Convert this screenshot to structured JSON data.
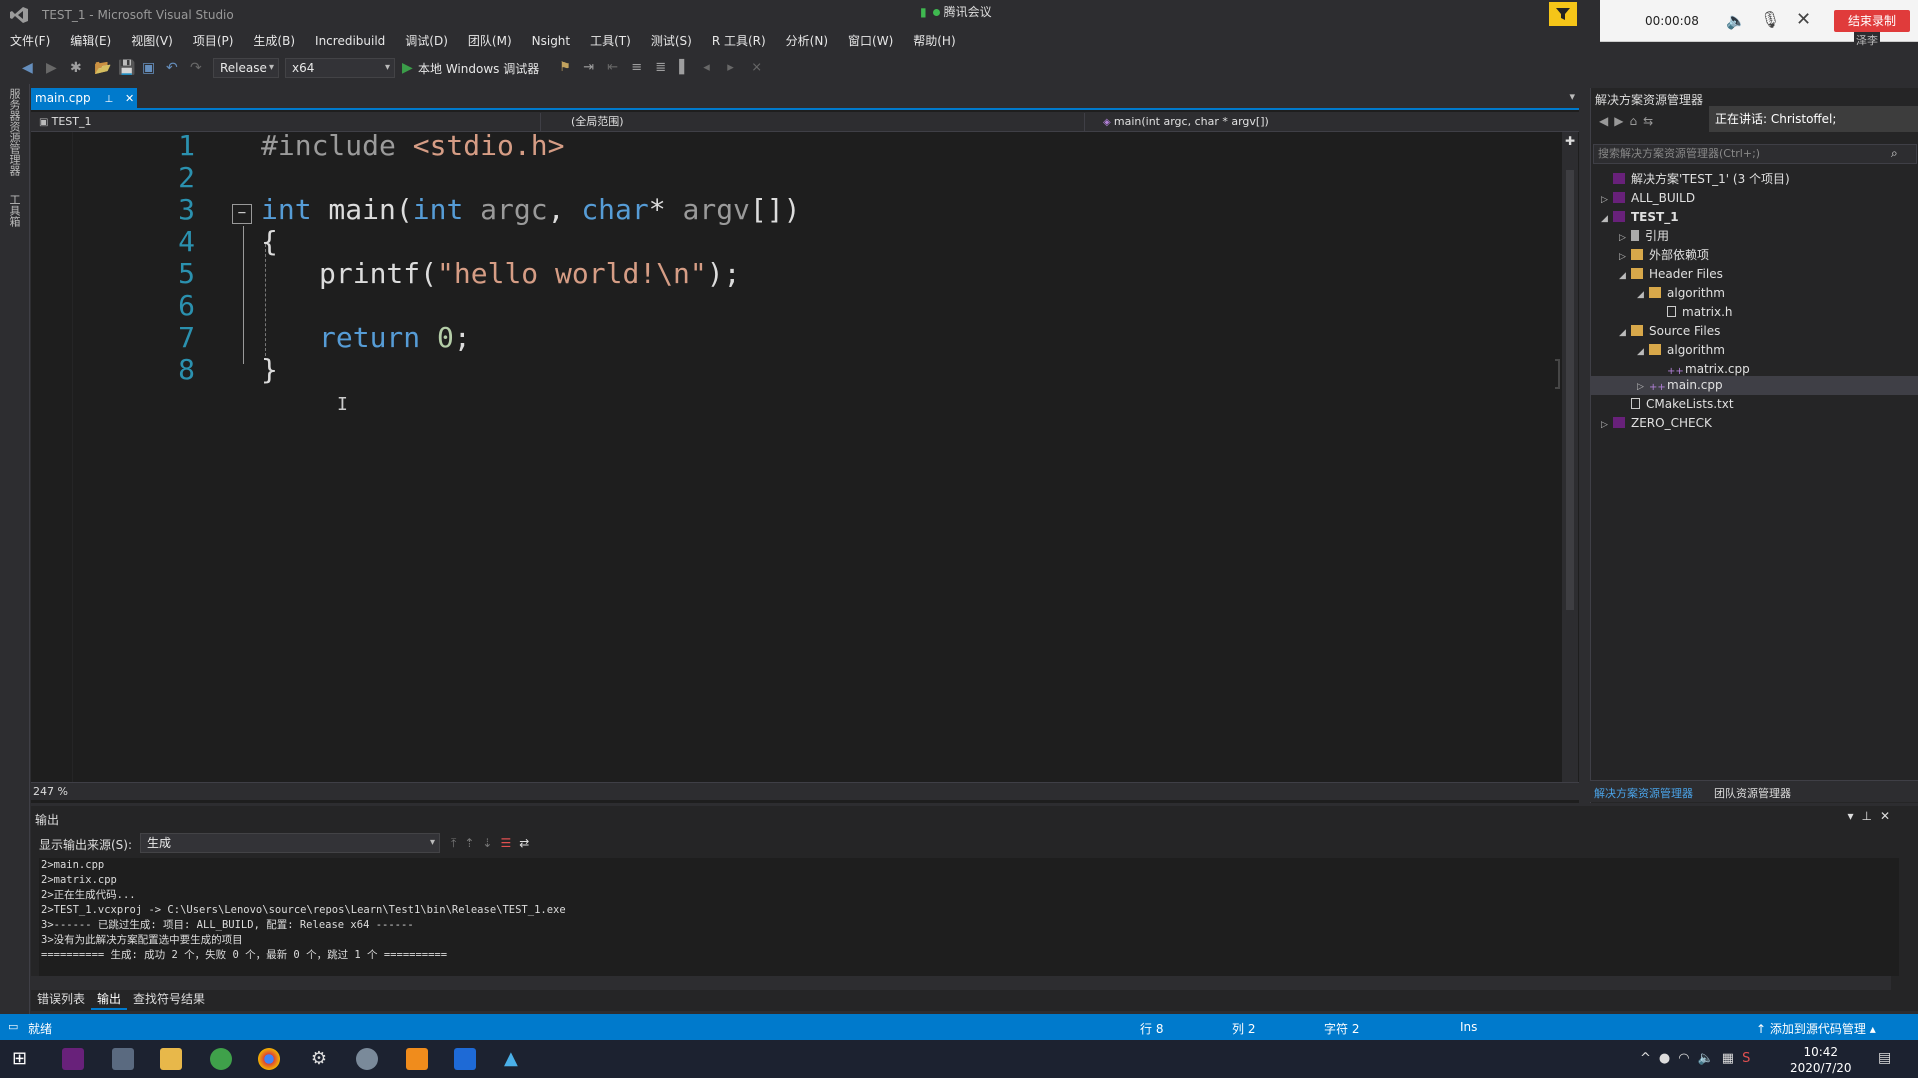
{
  "window": {
    "title": "TEST_1 - Microsoft Visual Studio",
    "meeting": "腾讯会议"
  },
  "recorder": {
    "time": "00:00:08",
    "stop_label": "结束录制",
    "overlay_name": "泽李"
  },
  "menu": [
    "文件(F)",
    "编辑(E)",
    "视图(V)",
    "项目(P)",
    "生成(B)",
    "Incredibuild",
    "调试(D)",
    "团队(M)",
    "Nsight",
    "工具(T)",
    "测试(S)",
    "R 工具(R)",
    "分析(N)",
    "窗口(W)",
    "帮助(H)"
  ],
  "toolbar": {
    "config": "Release",
    "platform": "x64",
    "debugger": "本地 Windows 调试器"
  },
  "left_strip": {
    "tab1": "服务器资源管理器",
    "tab2": "工具箱"
  },
  "editor": {
    "tab": "main.cpp",
    "nav_project": "TEST_1",
    "nav_scope": "(全局范围)",
    "nav_function": "main(int argc, char * argv[])",
    "zoom": "247 %",
    "line_numbers": [
      "1",
      "2",
      "3",
      "4",
      "5",
      "6",
      "7",
      "8"
    ],
    "code": {
      "l1_pp": "#include",
      "l1_inc": " <stdio.h>",
      "l3_kw": "int",
      "l3_a": " main(",
      "l3_kw2": "int",
      "l3_p1": " argc",
      "l3_b": ", ",
      "l3_kw3": "char",
      "l3_c": "* ",
      "l3_p2": "argv",
      "l3_d": "[])",
      "l4": "{",
      "l5_a": "printf(",
      "l5_str": "\"hello world!\\n\"",
      "l5_b": ");",
      "l7_kw": "return",
      "l7_num": " 0",
      "l7_b": ";",
      "l8": "}"
    }
  },
  "solution": {
    "title": "解决方案资源管理器",
    "speaking": "正在讲话: Christoffel;",
    "search_placeholder": "搜索解决方案资源管理器(Ctrl+;)",
    "tree": [
      {
        "label": "解决方案'TEST_1' (3 个项目)",
        "level": 0,
        "twisty": ""
      },
      {
        "label": "ALL_BUILD",
        "level": 1,
        "twisty": "▷"
      },
      {
        "label": "TEST_1",
        "level": 1,
        "twisty": "◢"
      },
      {
        "label": "引用",
        "level": 2,
        "twisty": "▷"
      },
      {
        "label": "外部依赖项",
        "level": 2,
        "twisty": "▷"
      },
      {
        "label": "Header Files",
        "level": 2,
        "twisty": "◢"
      },
      {
        "label": "algorithm",
        "level": 3,
        "twisty": "◢"
      },
      {
        "label": "matrix.h",
        "level": 4,
        "twisty": ""
      },
      {
        "label": "Source Files",
        "level": 2,
        "twisty": "◢"
      },
      {
        "label": "algorithm",
        "level": 3,
        "twisty": "◢"
      },
      {
        "label": "matrix.cpp",
        "level": 4,
        "twisty": ""
      },
      {
        "label": "main.cpp",
        "level": 3,
        "twisty": "▷"
      },
      {
        "label": "CMakeLists.txt",
        "level": 2,
        "twisty": ""
      },
      {
        "label": "ZERO_CHECK",
        "level": 1,
        "twisty": "▷"
      }
    ],
    "bottom_tabs": [
      "解决方案资源管理器",
      "团队资源管理器"
    ]
  },
  "output": {
    "title": "输出",
    "source_label": "显示输出来源(S):",
    "source_value": "生成",
    "lines": [
      "2>main.cpp",
      "2>matrix.cpp",
      "2>正在生成代码...",
      "2>TEST_1.vcxproj -> C:\\Users\\Lenovo\\source\\repos\\Learn\\Test1\\bin\\Release\\TEST_1.exe",
      "3>------ 已跳过生成: 项目: ALL_BUILD, 配置: Release x64 ------",
      "3>没有为此解决方案配置选中要生成的项目",
      "========== 生成: 成功 2 个，失败 0 个，最新 0 个，跳过 1 个 =========="
    ],
    "tabs": [
      "错误列表",
      "输出",
      "查找符号结果"
    ]
  },
  "status": {
    "ready": "就绪",
    "line": "行 8",
    "col": "列 2",
    "char": "字符 2",
    "mode": "Ins",
    "source_control": "添加到源代码管理"
  },
  "taskbar": {
    "time": "10:42",
    "date": "2020/7/20"
  }
}
